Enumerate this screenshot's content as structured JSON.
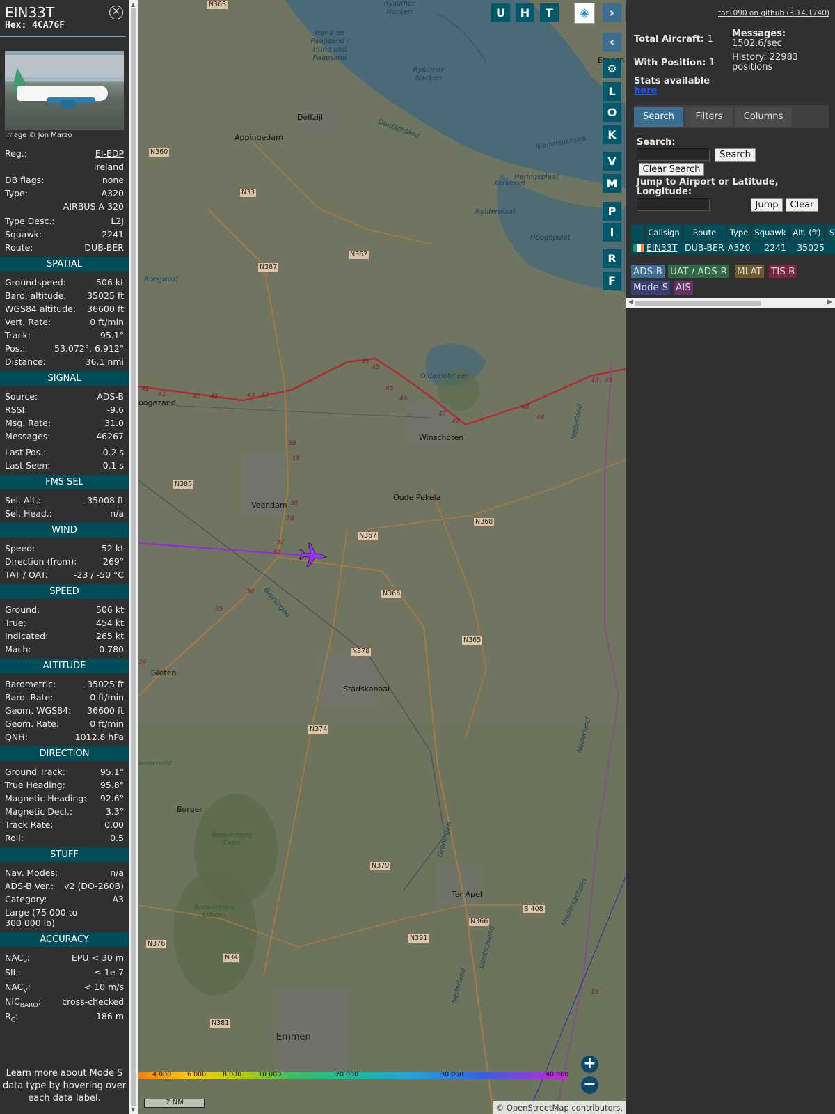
{
  "aircraft": {
    "callsign": "EIN33T",
    "hex_label": "Hex:",
    "hex": "4CA76F",
    "close_glyph": "⊗",
    "image_credit": "Image © Jon Marzo",
    "basic": [
      {
        "label": "Reg.:",
        "value": "EI-EDP"
      },
      {
        "label": "",
        "value": "Ireland"
      },
      {
        "label": "DB flags:",
        "value": "none"
      },
      {
        "label": "Type:",
        "value": "A320"
      },
      {
        "label": "",
        "value": "AIRBUS A-320"
      },
      {
        "label": "Type Desc.:",
        "value": "L2J"
      },
      {
        "label": "Squawk:",
        "value": "2241"
      },
      {
        "label": "Route:",
        "value": "DUB-BER"
      }
    ],
    "sections": [
      {
        "title": "SPATIAL",
        "rows": [
          {
            "label": "Groundspeed:",
            "value": "506 kt"
          },
          {
            "label": "Baro. altitude:",
            "value": "35025 ft"
          },
          {
            "label": "WGS84 altitude:",
            "value": "36600 ft"
          },
          {
            "label": "Vert. Rate:",
            "value": "0 ft/min"
          },
          {
            "label": "Track:",
            "value": "95.1°"
          },
          {
            "label": "Pos.:",
            "value": "53.072°, 6.912°"
          },
          {
            "label": "Distance:",
            "value": "36.1 nmi"
          }
        ]
      },
      {
        "title": "SIGNAL",
        "rows": [
          {
            "label": "Source:",
            "value": "ADS-B"
          },
          {
            "label": "RSSI:",
            "value": "-9.6"
          },
          {
            "label": "Msg. Rate:",
            "value": "31.0"
          },
          {
            "label": "Messages:",
            "value": "46267"
          },
          {
            "label": "Last Pos.:",
            "value": "0.2 s"
          },
          {
            "label": "Last Seen:",
            "value": "0.1 s"
          }
        ]
      },
      {
        "title": "FMS SEL",
        "rows": [
          {
            "label": "Sel. Alt.:",
            "value": "35008 ft"
          },
          {
            "label": "Sel. Head.:",
            "value": "n/a"
          }
        ]
      },
      {
        "title": "WIND",
        "rows": [
          {
            "label": "Speed:",
            "value": "52 kt"
          },
          {
            "label": "Direction (from):",
            "value": "269°"
          },
          {
            "label": "TAT / OAT:",
            "value": "-23 / -50 °C"
          }
        ]
      },
      {
        "title": "SPEED",
        "rows": [
          {
            "label": "Ground:",
            "value": "506 kt"
          },
          {
            "label": "True:",
            "value": "454 kt"
          },
          {
            "label": "Indicated:",
            "value": "265 kt"
          },
          {
            "label": "Mach:",
            "value": "0.780"
          }
        ]
      },
      {
        "title": "ALTITUDE",
        "rows": [
          {
            "label": "Barometric:",
            "value": "35025 ft"
          },
          {
            "label": "Baro. Rate:",
            "value": "0 ft/min"
          },
          {
            "label": "Geom. WGS84:",
            "value": "36600 ft"
          },
          {
            "label": "Geom. Rate:",
            "value": "0 ft/min"
          },
          {
            "label": "QNH:",
            "value": "1012.8 hPa"
          }
        ]
      },
      {
        "title": "DIRECTION",
        "rows": [
          {
            "label": "Ground Track:",
            "value": "95.1°"
          },
          {
            "label": "True Heading:",
            "value": "95.8°"
          },
          {
            "label": "Magnetic Heading:",
            "value": "92.6°"
          },
          {
            "label": "Magnetic Decl.:",
            "value": "3.3°"
          },
          {
            "label": "Track Rate:",
            "value": "0.00"
          },
          {
            "label": "Roll:",
            "value": "0.5"
          }
        ]
      },
      {
        "title": "STUFF",
        "rows": [
          {
            "label": "Nav. Modes:",
            "value": "n/a"
          },
          {
            "label": "ADS-B Ver.:",
            "value": "v2 (DO-260B)"
          },
          {
            "label": "Category:",
            "value": "A3"
          },
          {
            "label": "Large (75 000 to 300 000 lb)",
            "value": ""
          }
        ]
      },
      {
        "title": "ACCURACY",
        "rows": [
          {
            "label": "NACP:",
            "value": "EPU < 30 m"
          },
          {
            "label": "SIL:",
            "value": "≤ 1e-7"
          },
          {
            "label": "NACV:",
            "value": "< 10 m/s"
          },
          {
            "label": "NICBARO:",
            "value": "cross-checked"
          },
          {
            "label": "RC:",
            "value": "186 m"
          }
        ]
      }
    ],
    "learn_more": "Learn more about Mode S data type by hovering over each data label."
  },
  "map": {
    "top_buttons": [
      "U",
      "H",
      "T"
    ],
    "side_buttons": [
      "L",
      "O",
      "K",
      "V",
      "M",
      "P",
      "I",
      "R",
      "F"
    ],
    "nav_right": "›",
    "nav_left": "‹",
    "nav_expand": "◂▸",
    "settings_icon": "⚙",
    "layers_icon": "◈",
    "zoom_in": "+",
    "zoom_out": "−",
    "scale": "2 NM",
    "attribution": "© OpenStreetMap contributors.",
    "altitude_ticks": [
      "4 000",
      "6 000",
      "8 000",
      "10 000",
      "20 000",
      "30 000",
      "40 000"
    ],
    "places": [
      "Delfzijl",
      "Appingedam",
      "Winschoten",
      "Oude Pekela",
      "Veendam",
      "Stadskanaal",
      "Gieten",
      "Borger",
      "Ter Apel",
      "Emmen",
      "oogezand",
      "Emden"
    ],
    "roads": [
      "N363",
      "N360",
      "N33",
      "N387",
      "N362",
      "N385",
      "N367",
      "N368",
      "N366",
      "N365",
      "N378",
      "N374",
      "N379",
      "N376",
      "N34",
      "N391",
      "N366",
      "B 408",
      "N381"
    ],
    "waters": [
      "Hond-en Paapzand / Hund und Paapsand",
      "Rysumer Nacken",
      "Rysumer Nacken",
      "Heringsplaat",
      "Kerkeriet",
      "Reiderplaat",
      "Hoogeplaat",
      "Oldambtmeer",
      "Deutschland",
      "Niedersachsen",
      "Groningen",
      "Roegwold"
    ],
    "woods": [
      "Boswachterij Exloo",
      "Boswachterij Odoorn",
      "wenerveld"
    ],
    "borders": [
      "Nederland",
      "Niedersachsen",
      "Deutschland",
      "Nederland",
      "Groningen",
      "Nederland"
    ],
    "road_numbers": [
      "41",
      "41",
      "42",
      "42",
      "43",
      "43",
      "45",
      "45",
      "46",
      "46",
      "47",
      "47",
      "48",
      "48",
      "49",
      "49",
      "39",
      "39",
      "38",
      "38",
      "37",
      "37",
      "36",
      "35",
      "34",
      "19"
    ]
  },
  "stats": {
    "github": "tar1090 on github (3.14.1740)",
    "total_aircraft_label": "Total Aircraft:",
    "total_aircraft": "1",
    "with_position_label": "With Position:",
    "with_position": "1",
    "messages_label": "Messages:",
    "messages_rate": "1502.6/sec",
    "history_label": "History: 22983",
    "history_unit": "positions",
    "stats_available": "Stats available",
    "here": "here"
  },
  "tabs": [
    "Search",
    "Filters",
    "Columns"
  ],
  "search": {
    "label": "Search:",
    "value": "",
    "search_button": "Search",
    "clear_button": "Clear Search",
    "jump_label": "Jump to Airport or Latitude, Longitude:",
    "jump_value": "",
    "jump_button": "Jump",
    "clear_jump_button": "Clear"
  },
  "table": {
    "headers": [
      "",
      "Callsign",
      "Route",
      "Type",
      "Squawk",
      "Alt. (ft)",
      "S"
    ],
    "rows": [
      {
        "callsign": "EIN33T",
        "route": "DUB-BER",
        "type": "A320",
        "squawk": "2241",
        "alt": "35025"
      }
    ]
  },
  "sources": [
    {
      "label": "ADS-B",
      "color": "#3c6e91"
    },
    {
      "label": "UAT / ADS-R",
      "color": "#2f6a45"
    },
    {
      "label": "MLAT",
      "color": "#6e5a2a"
    },
    {
      "label": "TIS-B",
      "color": "#7a2740"
    },
    {
      "label": "Mode-S",
      "color": "#3a3f78"
    },
    {
      "label": "AIS",
      "color": "#6a3266"
    }
  ],
  "colors": {
    "section_header": "#004d5a",
    "track": "#a020f0",
    "aircraft": "#9b30ff",
    "panel_bg": "#303030"
  }
}
